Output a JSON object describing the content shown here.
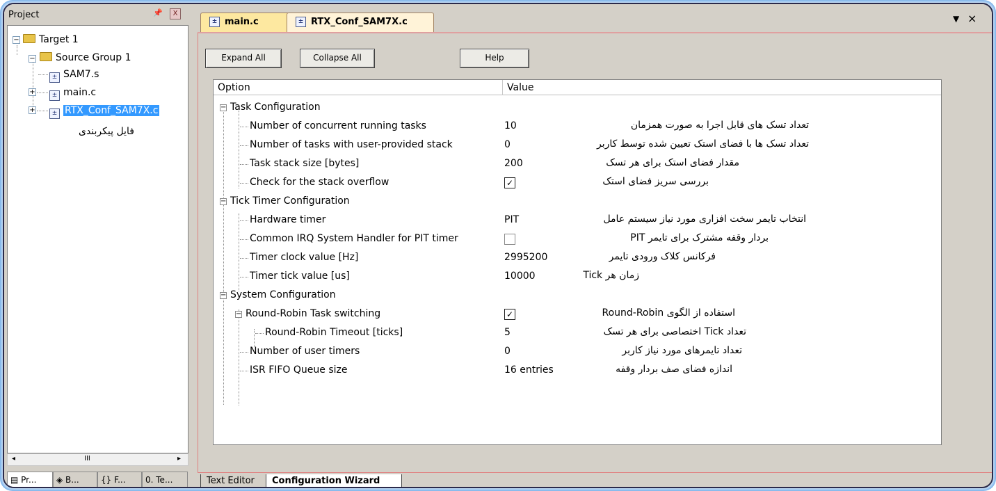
{
  "project_panel": {
    "title": "Project",
    "pin_icon": "pin-icon",
    "close_label": "X",
    "tree": {
      "target": "Target 1",
      "group": "Source Group 1",
      "files": [
        "SAM7.s",
        "main.c",
        "RTX_Conf_SAM7X.c"
      ]
    },
    "annotation": "فایل پیکربندی",
    "scroll_indicator": "III",
    "tabs": [
      "Pr...",
      "B...",
      "F...",
      "Te..."
    ]
  },
  "editor": {
    "tabs": [
      "main.c",
      "RTX_Conf_SAM7X.c"
    ],
    "active_tab": "RTX_Conf_SAM7X.c",
    "bottom_tabs": [
      "Text Editor",
      "Configuration Wizard"
    ],
    "active_bottom_tab": "Configuration Wizard"
  },
  "toolbar": {
    "expand_all": "Expand All",
    "collapse_all": "Collapse All",
    "help": "Help"
  },
  "grid": {
    "header_option": "Option",
    "header_value": "Value",
    "rows": [
      {
        "label": "Task Configuration",
        "value": "",
        "note": ""
      },
      {
        "label": "Number of concurrent running tasks",
        "value": "10",
        "note": "تعداد تسک های قابل اجرا به صورت همزمان"
      },
      {
        "label": "Number of tasks with user-provided stack",
        "value": "0",
        "note": "تعداد تسک ها با فضای استک تعیین شده توسط کاربر"
      },
      {
        "label": "Task stack size [bytes]",
        "value": "200",
        "note": "مقدار فضای استک برای هر تسک"
      },
      {
        "label": "Check for the stack overflow",
        "value": "",
        "checked": true,
        "note": "بررسی سریز فضای استک"
      },
      {
        "label": "Tick Timer Configuration",
        "value": "",
        "note": ""
      },
      {
        "label": "Hardware timer",
        "value": "PIT",
        "note": "انتخاب تایمر سخت افزاری مورد نیاز سیستم عامل"
      },
      {
        "label": "Common IRQ System Handler for PIT timer",
        "value": "",
        "checked": false,
        "note": "بردار وقفه مشترک برای تایمر PIT"
      },
      {
        "label": "Timer clock value [Hz]",
        "value": "2995200",
        "note": "فرکانس کلاک ورودی تایمر"
      },
      {
        "label": "Timer tick value [us]",
        "value": "10000",
        "note": "زمان هر Tick"
      },
      {
        "label": "System Configuration",
        "value": "",
        "note": ""
      },
      {
        "label": "Round-Robin Task switching",
        "value": "",
        "checked": true,
        "note": "استفاده از الگوی Round-Robin"
      },
      {
        "label": "Round-Robin Timeout [ticks]",
        "value": "5",
        "note": "تعداد Tick اختصاصی برای هر تسک"
      },
      {
        "label": "Number of user timers",
        "value": "0",
        "note": "تعداد تایمرهای مورد نیاز کاربر"
      },
      {
        "label": "ISR FIFO Queue size",
        "value": "16 entries",
        "note": "اندازه فضای صف بردار وقفه"
      }
    ]
  }
}
